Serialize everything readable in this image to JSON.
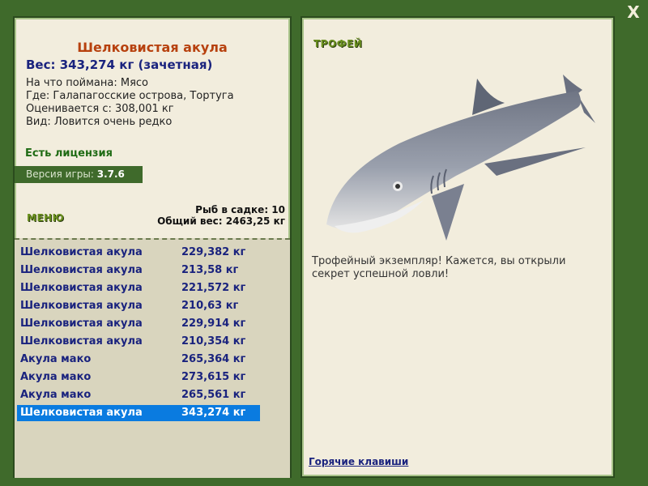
{
  "fish": {
    "title": "Шелковистая акула",
    "weight": "Вес: 343,274 кг (зачетная)",
    "caught_on": "На что поймана: Мясо",
    "where": "Где: Галапагосские острова, Тортуга",
    "value": "Оценивается с: 308,001 кг",
    "rarity": "Вид: Ловится очень редко"
  },
  "license": "Есть лицензия",
  "version": {
    "label": "Версия игры:",
    "value": "3.7.6"
  },
  "menu_label": "МЕНЮ",
  "stats": {
    "count": "Рыб в садке: 10",
    "total": "Общий вес: 2463,25 кг"
  },
  "catch_list": [
    {
      "name": "Шелковистая акула",
      "weight": "229,382 кг"
    },
    {
      "name": "Шелковистая акула",
      "weight": "213,58 кг"
    },
    {
      "name": "Шелковистая акула",
      "weight": "221,572 кг"
    },
    {
      "name": "Шелковистая акула",
      "weight": "210,63 кг"
    },
    {
      "name": "Шелковистая акула",
      "weight": "229,914 кг"
    },
    {
      "name": "Шелковистая акула",
      "weight": "210,354 кг"
    },
    {
      "name": "Акула мако",
      "weight": "265,364 кг"
    },
    {
      "name": "Акула мако",
      "weight": "273,615 кг"
    },
    {
      "name": "Акула мако",
      "weight": "265,561 кг"
    },
    {
      "name": "Шелковистая акула",
      "weight": "343,274 кг"
    }
  ],
  "selected_index": 9,
  "trophy_label": "ТРОФЕЙ",
  "trophy_description": "Трофейный экземпляр! Кажется, вы открыли секрет успешной ловли!",
  "hotkeys_link": "Горячие клавиши",
  "close_label": "X",
  "colors": {
    "frame_green": "#3f6a2b",
    "panel": "#f2eddd",
    "list_bg": "#d9d5be",
    "selection": "#0a7be0",
    "title": "#b7410e",
    "text_blue": "#1a237e"
  }
}
